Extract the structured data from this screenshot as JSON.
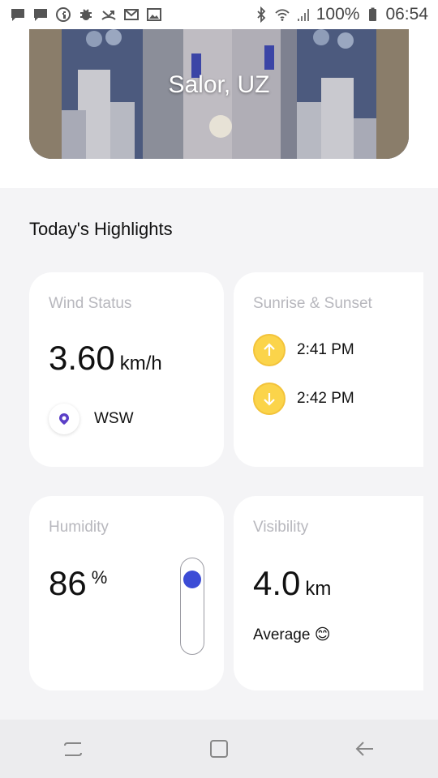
{
  "status_bar": {
    "battery_text": "100%",
    "time": "06:54"
  },
  "hero": {
    "location": "Salor, UZ"
  },
  "highlights": {
    "title": "Today's Highlights",
    "wind": {
      "title": "Wind Status",
      "value": "3.60",
      "unit": "km/h",
      "direction": "WSW"
    },
    "sun": {
      "title": "Sunrise & Sunset",
      "sunrise": "2:41 PM",
      "sunset": "2:42 PM"
    },
    "humidity": {
      "title": "Humidity",
      "value": "86",
      "unit": "%",
      "level_percent": 86
    },
    "visibility": {
      "title": "Visibility",
      "value": "4.0",
      "unit": "km",
      "note": "Average 😊"
    }
  },
  "colors": {
    "accent": "#3c4cd6",
    "sun_yellow": "#fbd44a",
    "muted_text": "#b7b7bd"
  }
}
